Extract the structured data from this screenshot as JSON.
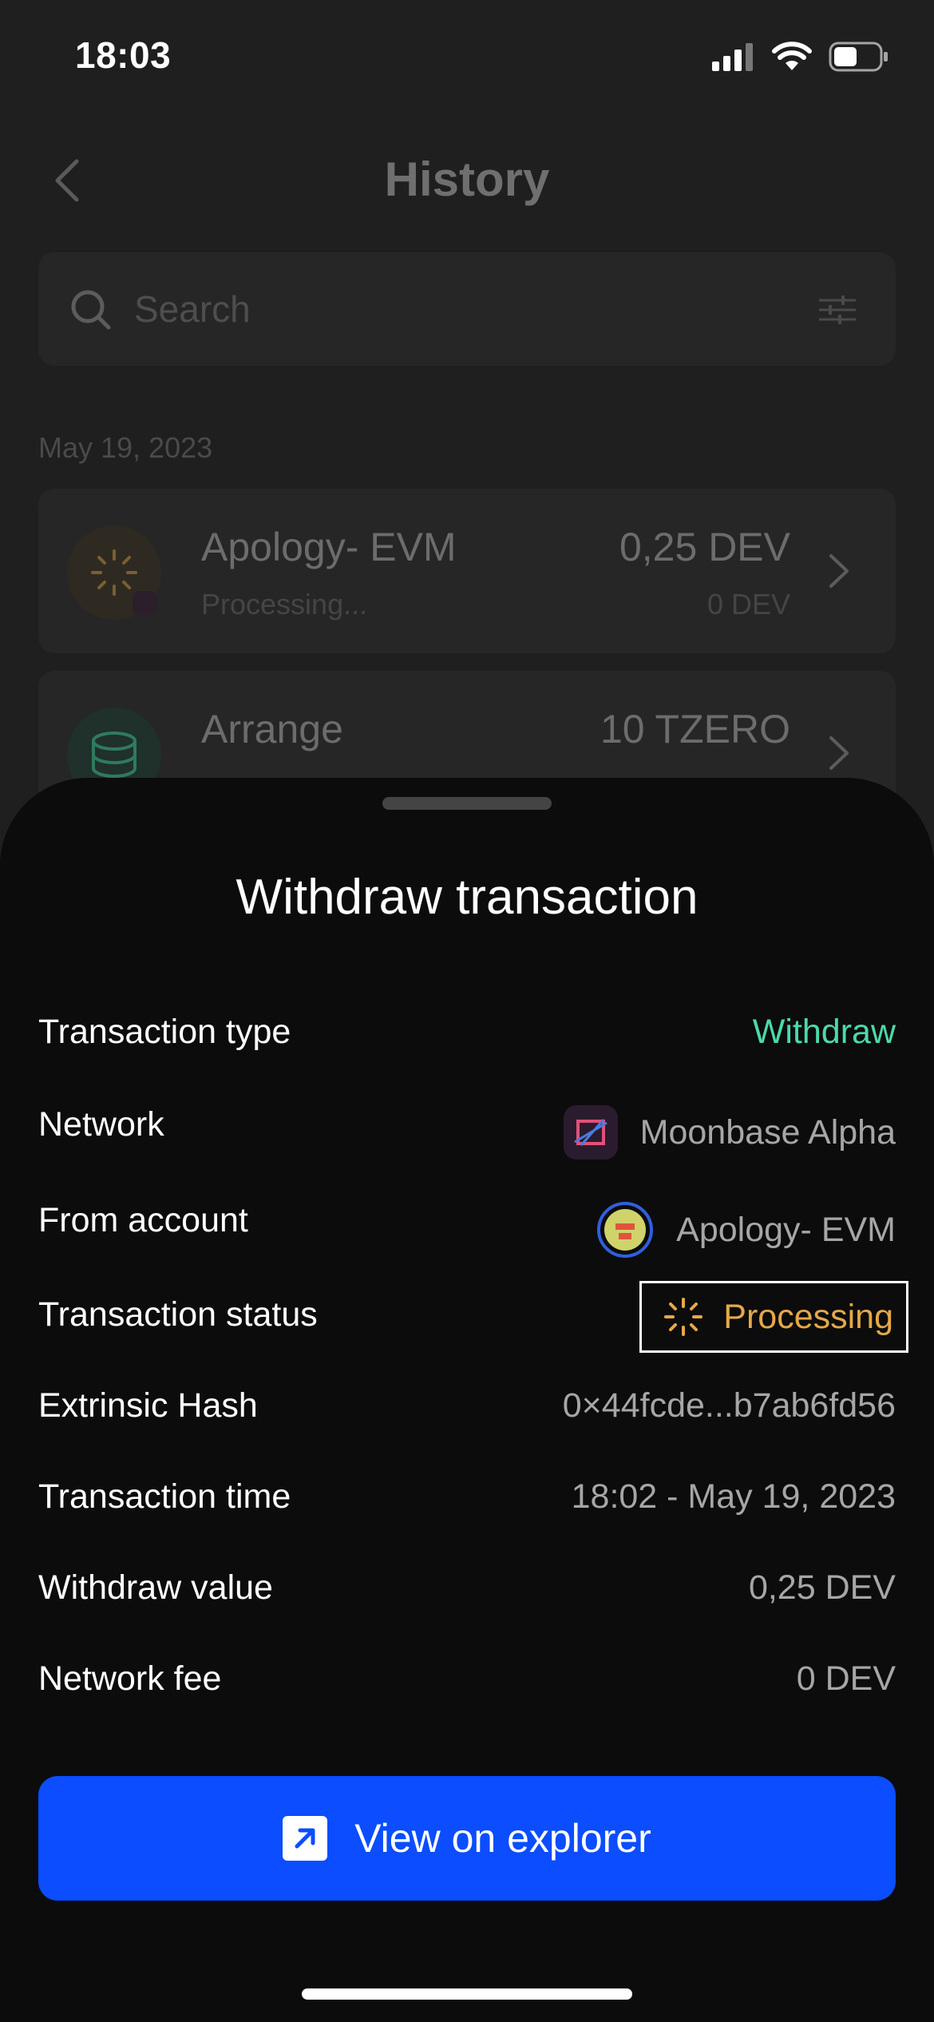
{
  "status_bar": {
    "time": "18:03"
  },
  "background": {
    "title": "History",
    "search_placeholder": "Search",
    "date_header": "May 19, 2023",
    "items": [
      {
        "name": "Apology- EVM",
        "status": "Processing...",
        "amount": "0,25 DEV",
        "fee": "0 DEV"
      },
      {
        "name": "Arrange",
        "status": "",
        "amount": "10 TZERO",
        "fee": ""
      }
    ]
  },
  "sheet": {
    "title": "Withdraw transaction",
    "rows": [
      {
        "label": "Transaction type",
        "value": "Withdraw"
      },
      {
        "label": "Network",
        "value": "Moonbase Alpha"
      },
      {
        "label": "From account",
        "value": "Apology- EVM"
      },
      {
        "label": "Transaction status",
        "value": "Processing"
      },
      {
        "label": "Extrinsic Hash",
        "value": "0×44fcde...b7ab6fd56"
      },
      {
        "label": "Transaction time",
        "value": "18:02 - May 19, 2023"
      },
      {
        "label": "Withdraw value",
        "value": "0,25 DEV"
      },
      {
        "label": "Network fee",
        "value": "0 DEV"
      }
    ],
    "explorer_button": "View on explorer"
  },
  "colors": {
    "accent": "#0b4dff",
    "withdraw": "#4cd9ac",
    "processing": "#e5a849"
  },
  "icons": [
    "signal-icon",
    "wifi-icon",
    "battery-icon",
    "back-chevron-icon",
    "search-icon",
    "filter-icon",
    "chevron-right-icon",
    "moonbase-icon",
    "account-avatar-icon",
    "spinner-icon",
    "external-link-icon"
  ]
}
